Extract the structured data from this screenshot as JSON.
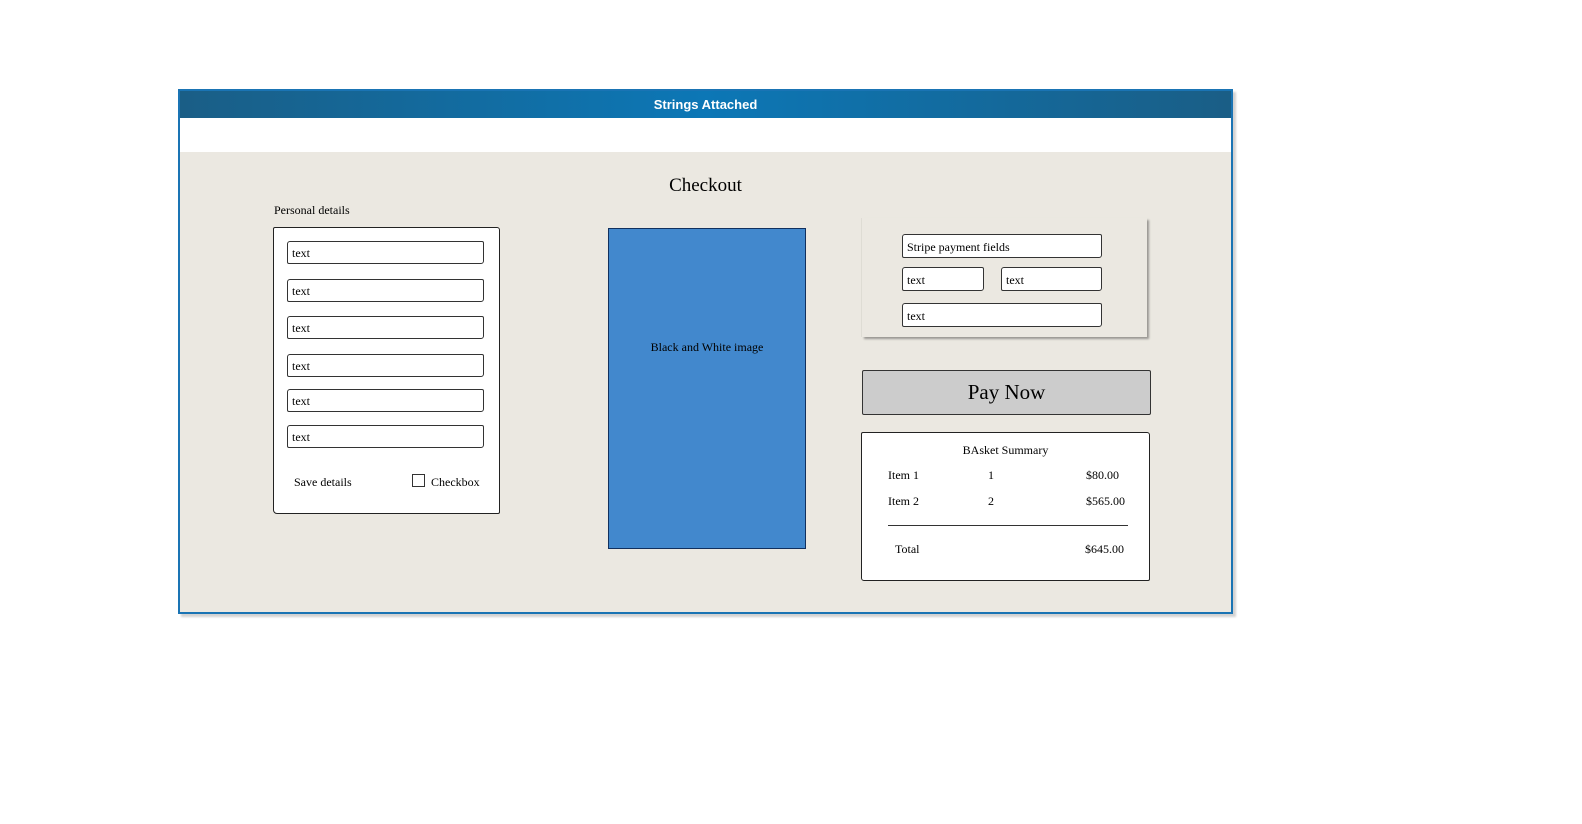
{
  "window": {
    "title": "Strings Attached"
  },
  "page": {
    "title": "Checkout"
  },
  "personal_details": {
    "label": "Personal details",
    "fields": [
      "text",
      "text",
      "text",
      "text",
      "text",
      "text"
    ],
    "save_label": "Save details",
    "checkbox_label": "Checkbox"
  },
  "image": {
    "label": "Black and White image"
  },
  "stripe": {
    "fields": [
      "Stripe payment fields",
      "text",
      "text",
      "text"
    ]
  },
  "pay_button": {
    "label": "Pay Now"
  },
  "basket": {
    "title": "BAsket Summary",
    "items": [
      {
        "name": "Item 1",
        "qty": "1",
        "price": "$80.00"
      },
      {
        "name": "Item 2",
        "qty": "2",
        "price": "$565.00"
      }
    ],
    "total_label": "Total",
    "total_value": "$645.00"
  },
  "colors": {
    "titlebar": "#0c77b6",
    "window_bg": "#ebe8e1",
    "image_fill": "#4288cd",
    "button_bg": "#cccccc"
  }
}
